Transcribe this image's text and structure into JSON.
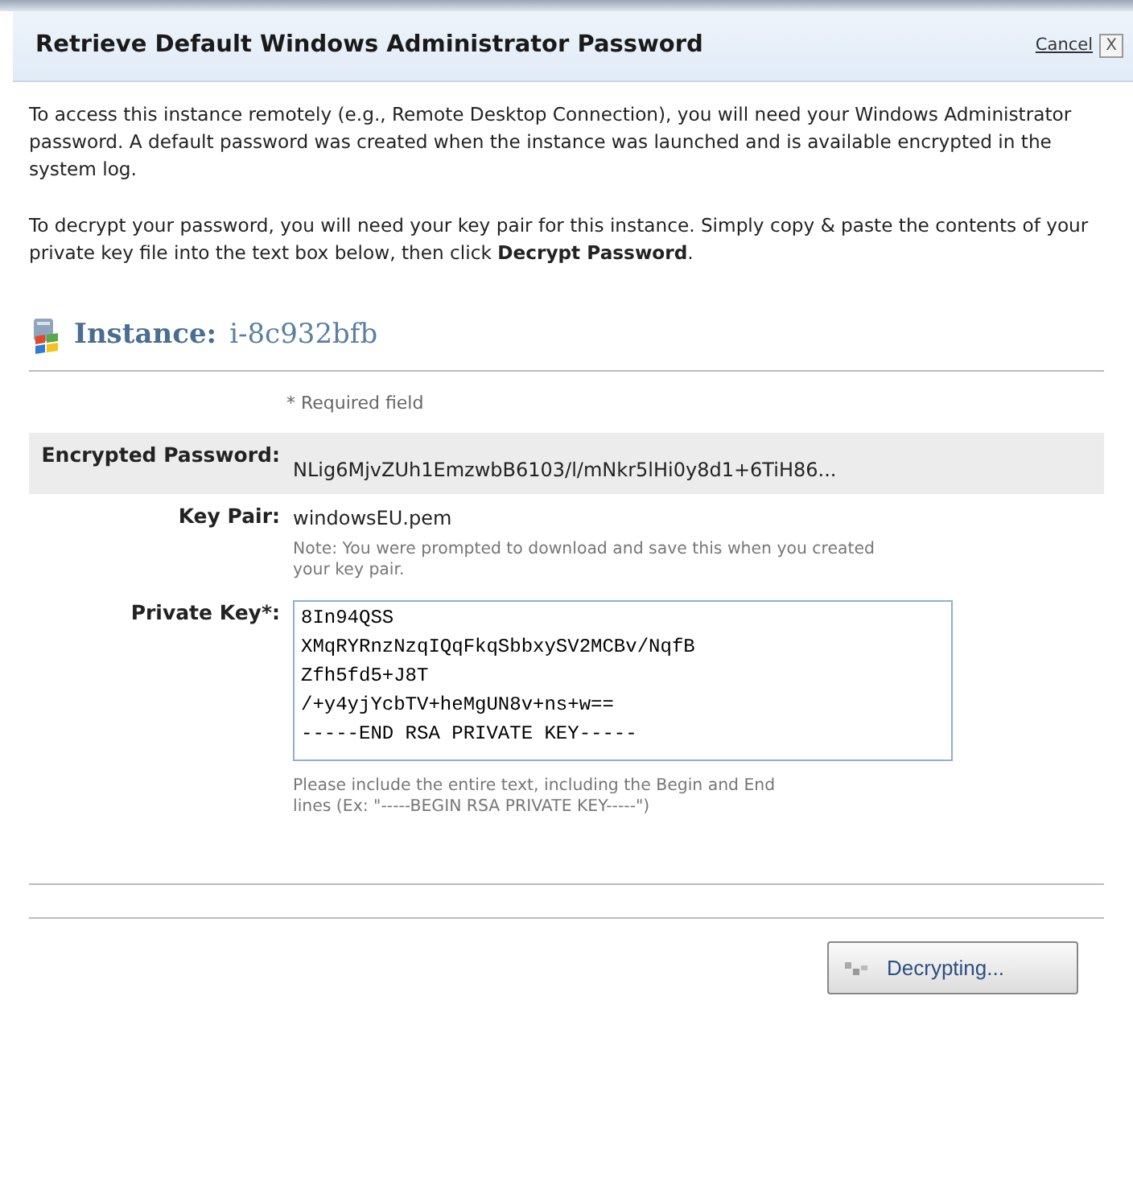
{
  "dialog": {
    "title": "Retrieve Default Windows Administrator Password",
    "cancel": "Cancel",
    "close": "X"
  },
  "paragraphs": [
    "To access this instance remotely (e.g., Remote Desktop Connection), you will need your Windows Administrator password. A default password was created when the instance was launched and is available encrypted in the system log.",
    "To decrypt your password, you will need your key pair for this instance. Simply copy & paste the contents of your private key file into the text box below, then click **Decrypt Password**."
  ],
  "instance": {
    "label": "Instance:",
    "id": "i-8c932bfb"
  },
  "required_note": "* Required field",
  "fields": [
    {
      "kind": "text",
      "label": "Encrypted Password:",
      "value": "NLig6MjvZUh1EmzwbB6103/l/mNkr5lHi0y8d1+6TiH86...",
      "shaded": true
    },
    {
      "kind": "text",
      "label": "Key Pair:",
      "value": "windowsEU.pem",
      "note": "Note: You were prompted to download and save this when you created your key pair.",
      "shaded": false
    },
    {
      "kind": "textarea",
      "label": "Private Key*:",
      "value": "8In94QSS\nXMqRYRnzNzqIQqFkqSbbxySV2MCBv/NqfB\nZfh5fd5+J8T\n/+y4yjYcbTV+heMgUN8v+ns+w==\n-----END RSA PRIVATE KEY-----",
      "note": "Please include the entire text, including the Begin and End lines (Ex: \"-----BEGIN RSA PRIVATE KEY-----\")",
      "shaded": false
    }
  ],
  "button": {
    "label": "Decrypting..."
  }
}
